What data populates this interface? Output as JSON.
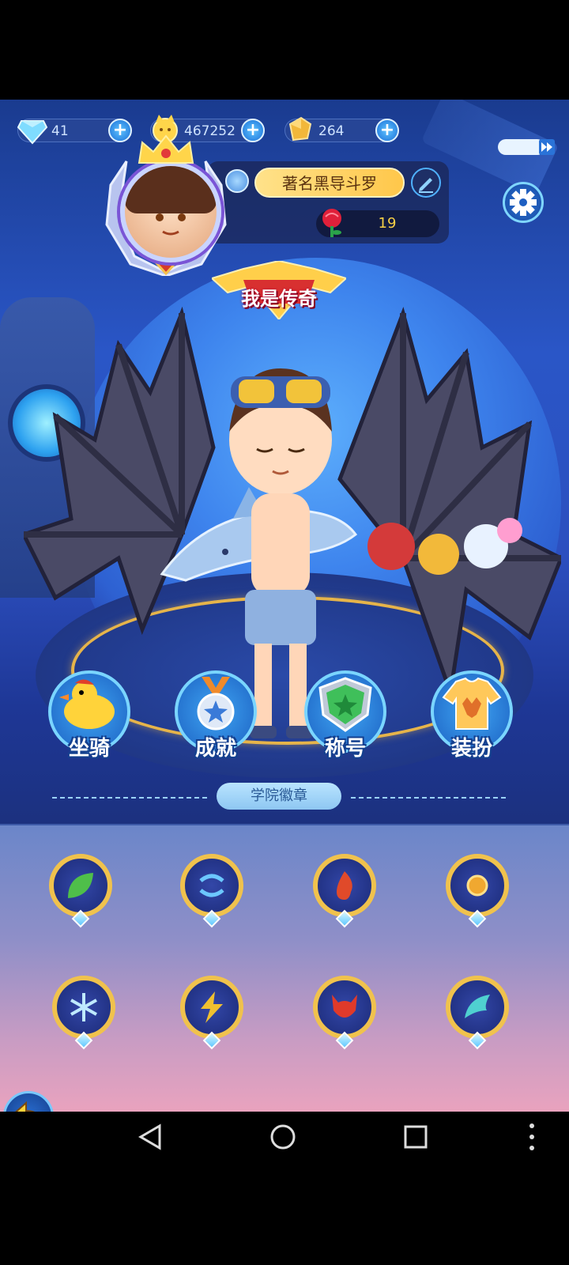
{
  "currencies": [
    {
      "name": "diamond",
      "value": "41",
      "icon": "diamond-icon"
    },
    {
      "name": "cat-coin",
      "value": "467252",
      "icon": "cat-coin-icon"
    },
    {
      "name": "gold-ore",
      "value": "264",
      "icon": "gold-ore-icon"
    }
  ],
  "profile": {
    "name": "著名黑导斗罗",
    "rose_count": "19",
    "title": "我是传奇"
  },
  "functions": [
    {
      "label": "坐骑",
      "icon": "duck-mount-icon"
    },
    {
      "label": "成就",
      "icon": "medal-icon"
    },
    {
      "label": "称号",
      "icon": "title-shield-icon"
    },
    {
      "label": "装扮",
      "icon": "outfit-sweater-icon"
    }
  ],
  "section": {
    "label": "学院徽章"
  },
  "badges": [
    {
      "icon": "leaf-badge-icon",
      "color": "#4fbf4a"
    },
    {
      "icon": "wind-badge-icon",
      "color": "#3fa4f2"
    },
    {
      "icon": "fire-badge-icon",
      "color": "#e04a2a"
    },
    {
      "icon": "sun-badge-icon",
      "color": "#f0a830"
    },
    {
      "icon": "snowflake-badge-icon",
      "color": "#6cc7ff"
    },
    {
      "icon": "lightning-badge-icon",
      "color": "#f0c030"
    },
    {
      "icon": "demon-badge-icon",
      "color": "#e03a2a"
    },
    {
      "icon": "wing-badge-icon",
      "color": "#4fd0d0"
    }
  ],
  "nav": {
    "back": "back-nav-icon",
    "home": "home-nav-icon",
    "recent": "recent-apps-icon",
    "more": "more-icon"
  }
}
